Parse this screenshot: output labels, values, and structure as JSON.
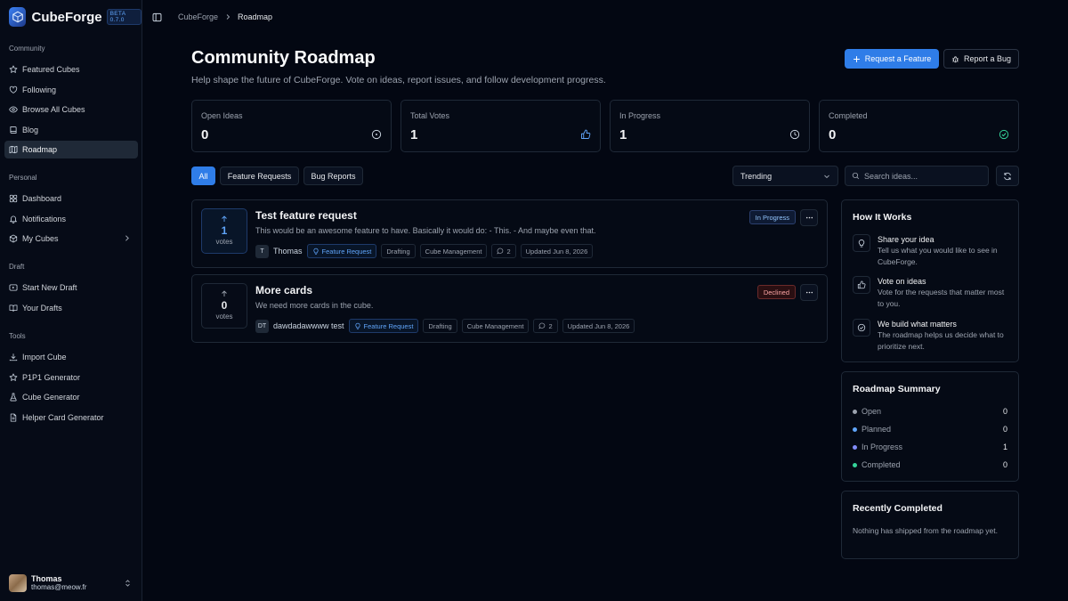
{
  "brand": {
    "name": "CubeForge",
    "version": "BETA 0.7.0"
  },
  "sidebar": {
    "sections": [
      {
        "heading": "Community",
        "items": [
          {
            "label": "Featured Cubes",
            "icon": "star-icon"
          },
          {
            "label": "Following",
            "icon": "heart-icon"
          },
          {
            "label": "Browse All Cubes",
            "icon": "eye-icon"
          },
          {
            "label": "Blog",
            "icon": "book-icon"
          },
          {
            "label": "Roadmap",
            "icon": "map-icon",
            "active": true
          }
        ]
      },
      {
        "heading": "Personal",
        "items": [
          {
            "label": "Dashboard",
            "icon": "grid-icon"
          },
          {
            "label": "Notifications",
            "icon": "bell-icon"
          },
          {
            "label": "My Cubes",
            "icon": "box-icon",
            "expandable": true
          }
        ]
      },
      {
        "heading": "Draft",
        "items": [
          {
            "label": "Start New Draft",
            "icon": "play-icon"
          },
          {
            "label": "Your Drafts",
            "icon": "book-open-icon"
          }
        ]
      },
      {
        "heading": "Tools",
        "items": [
          {
            "label": "Import Cube",
            "icon": "download-icon"
          },
          {
            "label": "P1P1 Generator",
            "icon": "star-icon"
          },
          {
            "label": "Cube Generator",
            "icon": "flask-icon"
          },
          {
            "label": "Helper Card Generator",
            "icon": "file-icon"
          }
        ]
      }
    ],
    "user": {
      "name": "Thomas",
      "email": "thomas@meow.fr"
    }
  },
  "breadcrumb": {
    "root": "CubeForge",
    "current": "Roadmap"
  },
  "page": {
    "title": "Community Roadmap",
    "subtitle": "Help shape the future of CubeForge. Vote on ideas, report issues, and follow development progress.",
    "request_button": "Request a Feature",
    "bug_button": "Report a Bug"
  },
  "stats": [
    {
      "label": "Open Ideas",
      "value": "0",
      "icon": "circle-dot-icon"
    },
    {
      "label": "Total Votes",
      "value": "1",
      "icon": "thumbs-up-icon"
    },
    {
      "label": "In Progress",
      "value": "1",
      "icon": "clock-icon"
    },
    {
      "label": "Completed",
      "value": "0",
      "icon": "check-circle-icon"
    }
  ],
  "filters": {
    "all": "All",
    "features": "Feature Requests",
    "bugs": "Bug Reports",
    "active": "All"
  },
  "sort": {
    "selected": "Trending"
  },
  "search": {
    "placeholder": "Search ideas..."
  },
  "ideas": [
    {
      "title": "Test feature request",
      "description": "This would be an awesome feature to have. Basically it would do: - This. - And maybe even that.",
      "votes": "1",
      "votes_label": "votes",
      "voted": true,
      "author_initials": "T",
      "author": "Thomas",
      "type": "Feature Request",
      "tags": [
        "Drafting",
        "Cube Management"
      ],
      "comments": "2",
      "updated": "Updated Jun 8, 2026",
      "status": "In Progress"
    },
    {
      "title": "More cards",
      "description": "We need more cards in the cube.",
      "votes": "0",
      "votes_label": "votes",
      "voted": false,
      "author_initials": "DT",
      "author": "dawdadawwww test",
      "type": "Feature Request",
      "tags": [
        "Drafting",
        "Cube Management"
      ],
      "comments": "2",
      "updated": "Updated Jun 8, 2026",
      "status": "Declined"
    }
  ],
  "how_it_works": {
    "title": "How It Works",
    "steps": [
      {
        "title": "Share your idea",
        "text": "Tell us what you would like to see in CubeForge.",
        "icon": "lightbulb-icon"
      },
      {
        "title": "Vote on ideas",
        "text": "Vote for the requests that matter most to you.",
        "icon": "thumbs-up-icon"
      },
      {
        "title": "We build what matters",
        "text": "The roadmap helps us decide what to prioritize next.",
        "icon": "check-circle-icon"
      }
    ]
  },
  "summary": {
    "title": "Roadmap Summary",
    "rows": [
      {
        "label": "Open",
        "count": "0",
        "color": "#9ca3af"
      },
      {
        "label": "Planned",
        "count": "0",
        "color": "#60a5fa"
      },
      {
        "label": "In Progress",
        "count": "1",
        "color": "#818cf8"
      },
      {
        "label": "Completed",
        "count": "0",
        "color": "#34d399"
      }
    ]
  },
  "recently_completed": {
    "title": "Recently Completed",
    "empty": "Nothing has shipped from the roadmap yet."
  },
  "colors": {
    "accent": "#2f7de8",
    "background": "#030712",
    "declined": "#fca5a5",
    "in_progress": "#93c5fd"
  }
}
